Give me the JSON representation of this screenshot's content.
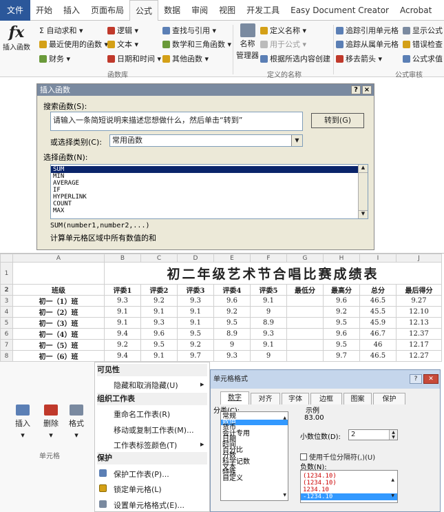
{
  "ribbon": {
    "tabs": [
      "文件",
      "开始",
      "插入",
      "页面布局",
      "公式",
      "数据",
      "审阅",
      "视图",
      "开发工具",
      "Easy Document Creator",
      "Acrobat"
    ],
    "active_tab": "公式",
    "insert_function": "插入函数",
    "fx": "fx",
    "autosum": "Σ 自动求和 ▾",
    "recent": "最近使用的函数 ▾",
    "finance": "财务 ▾",
    "logic": "逻辑 ▾",
    "text": "文本 ▾",
    "datetime": "日期和时间 ▾",
    "lookup": "查找与引用 ▾",
    "math": "数学和三角函数 ▾",
    "other": "其他函数 ▾",
    "name_mgr_1": "名称",
    "name_mgr_2": "管理器",
    "define_name": "定义名称 ▾",
    "use_in_formula": "用于公式 ▾",
    "create_from_sel": "根据所选内容创建",
    "trace_prec": "追踪引用单元格",
    "trace_dep": "追踪从属单元格",
    "remove_arrows": "移去箭头 ▾",
    "show_formulas": "显示公式",
    "error_check": "错误检查",
    "eval_formula": "公式求值",
    "group_lib": "函数库",
    "group_names": "定义的名称",
    "group_audit": "公式审核"
  },
  "dialog": {
    "title": "插入函数",
    "help": "?",
    "close": "×",
    "search_label": "搜索函数(S):",
    "search_value": "请输入一条简短说明来描述您想做什么，然后单击“转到”",
    "go": "转到(G)",
    "category_label": "或选择类别(C):",
    "category_value": "常用函数",
    "select_label": "选择函数(N):",
    "functions": [
      "SUM",
      "MIN",
      "AVERAGE",
      "IF",
      "HYPERLINK",
      "COUNT",
      "MAX"
    ],
    "selected": "SUM",
    "syntax": "SUM(number1,number2,...)",
    "description": "计算单元格区域中所有数值的和"
  },
  "sheet": {
    "columns": [
      "A",
      "B",
      "C",
      "D",
      "E",
      "F",
      "G",
      "H",
      "I",
      "J"
    ],
    "row_numbers": [
      "1",
      "2",
      "3",
      "4",
      "5",
      "6",
      "7",
      "8"
    ],
    "title": "初二年级艺术节合唱比赛成绩表",
    "headers": [
      "班级",
      "评委1",
      "评委2",
      "评委3",
      "评委4",
      "评委5",
      "最低分",
      "最高分",
      "总分",
      "最后得分"
    ],
    "rows": [
      [
        "初一（1）班",
        "9.3",
        "9.2",
        "9.3",
        "9.6",
        "9.1",
        "",
        "9.6",
        "46.5",
        "9.27"
      ],
      [
        "初一（2）班",
        "9.1",
        "9.1",
        "9.1",
        "9.2",
        "9",
        "",
        "9.2",
        "45.5",
        "12.10"
      ],
      [
        "初一（3）班",
        "9.1",
        "9.3",
        "9.1",
        "9.5",
        "8.9",
        "",
        "9.5",
        "45.9",
        "12.13"
      ],
      [
        "初一（4）班",
        "9.4",
        "9.6",
        "9.5",
        "8.9",
        "9.3",
        "",
        "9.6",
        "46.7",
        "12.37"
      ],
      [
        "初一（5）班",
        "9.2",
        "9.5",
        "9.2",
        "9",
        "9.1",
        "",
        "9.5",
        "46",
        "12.17"
      ],
      [
        "初一（6）班",
        "9.4",
        "9.1",
        "9.7",
        "9.3",
        "9",
        "",
        "9.7",
        "46.5",
        "12.27"
      ]
    ]
  },
  "cells_group": {
    "insert": "插入",
    "delete": "删除",
    "format": "格式",
    "group": "单元格"
  },
  "menu": {
    "visibility": "可见性",
    "hide": "隐藏和取消隐藏(U)",
    "organize": "组织工作表",
    "rename": "重命名工作表(R)",
    "move": "移动或复制工作表(M)...",
    "tabcolor": "工作表标签颜色(T)",
    "protect": "保护",
    "protect_sheet": "保护工作表(P)...",
    "lock": "锁定单元格(L)",
    "format_cells": "设置单元格格式(E)..."
  },
  "format_dialog": {
    "title": "单元格格式",
    "tabs": [
      "数字",
      "对齐",
      "字体",
      "边框",
      "图案",
      "保护"
    ],
    "category_label": "分类(C):",
    "categories": [
      "常规",
      "数值",
      "货币",
      "会计专用",
      "日期",
      "时间",
      "百分比",
      "分数",
      "科学记数",
      "文本",
      "特殊",
      "自定义"
    ],
    "selected_category": "数值",
    "sample_label": "示例",
    "sample_value": "83.00",
    "decimals_label": "小数位数(D):",
    "decimals_value": "2",
    "thousands_label": "使用千位分隔符(,)(U)",
    "negative_label": "负数(N):",
    "negatives": [
      "(1234.10)",
      "(1234.10)",
      "1234.10",
      "-1234.10"
    ],
    "selected_negative": "-1234.10"
  },
  "colors": {
    "file_tab": "#2b579a",
    "selection": "#0a246a",
    "red_negative": "#cc0000"
  }
}
